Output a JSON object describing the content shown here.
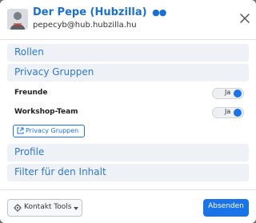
{
  "header": {
    "title": "Der Pepe (Hubzilla)",
    "title_icon": "people-icon",
    "subtitle": "pepecyb@hub.hubzilla.hu",
    "close_icon": "close-icon"
  },
  "sections": {
    "roles": "Rollen",
    "privacy_groups": "Privacy Gruppen",
    "profile": "Profile",
    "content_filter": "Filter für den Inhalt"
  },
  "privacy_groups": [
    {
      "label": "Freunde",
      "toggle_text": "Ja",
      "on": true
    },
    {
      "label": "Workshop-Team",
      "toggle_text": "Ja",
      "on": true
    }
  ],
  "privacy_groups_link": "Privacy Gruppen",
  "footer": {
    "tools_label": "Kontakt Tools",
    "submit_label": "Absenden"
  },
  "colors": {
    "accent": "#1a73e8",
    "section_bg": "#eef2f7",
    "section_text": "#2f78cc"
  }
}
